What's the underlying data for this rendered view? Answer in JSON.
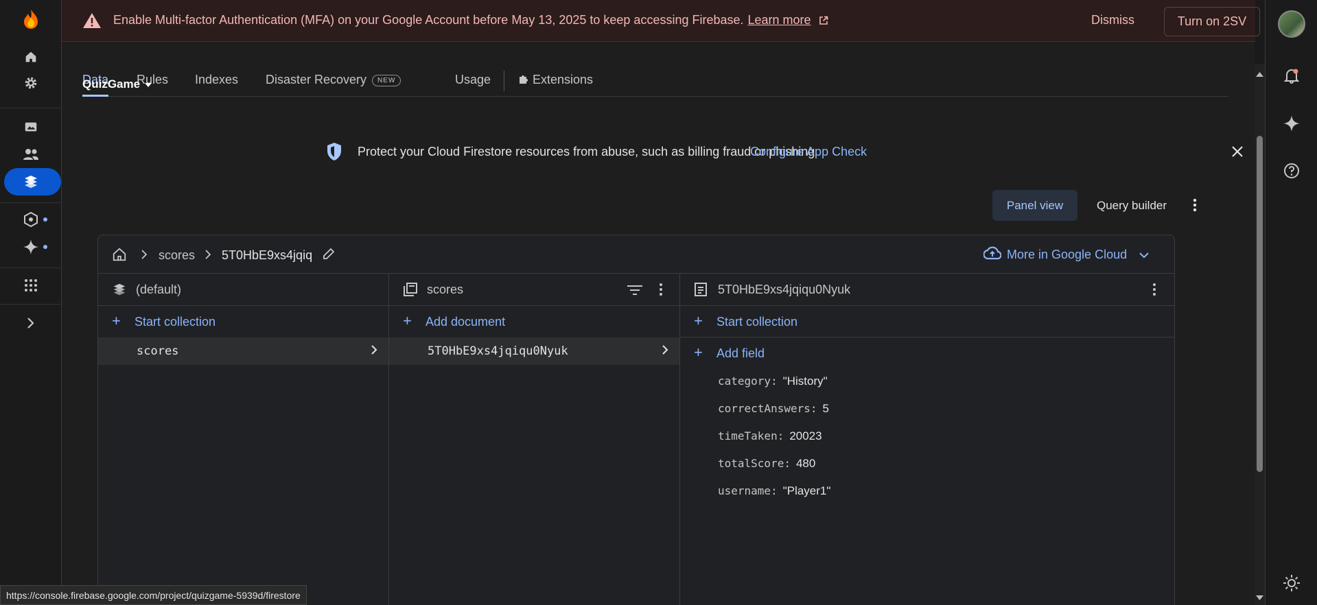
{
  "banner": {
    "message": "Enable Multi-factor Authentication (MFA) on your Google Account before May 13, 2025 to keep accessing Firebase.",
    "learn_more": "Learn more",
    "dismiss": "Dismiss",
    "turn_on": "Turn on 2SV"
  },
  "project": {
    "name": "QuizGame"
  },
  "tabs": [
    {
      "label": "Data"
    },
    {
      "label": "Rules"
    },
    {
      "label": "Indexes"
    },
    {
      "label": "Disaster Recovery",
      "badge": "NEW"
    },
    {
      "label": "Usage"
    },
    {
      "label": "Extensions"
    }
  ],
  "appcheck": {
    "text": "Protect your Cloud Firestore resources from abuse, such as billing fraud or phishing",
    "link": "Configure App Check"
  },
  "view": {
    "panel_view": "Panel view",
    "query_builder": "Query builder"
  },
  "breadcrumb": {
    "collection": "scores",
    "document": "5T0HbE9xs4jqiq"
  },
  "more_cloud": "More in Google Cloud",
  "columns": {
    "database": {
      "title": "(default)",
      "add_label": "Start collection",
      "items": [
        "scores"
      ]
    },
    "collection": {
      "title": "scores",
      "add_label": "Add document",
      "items": [
        "5T0HbE9xs4jqiqu0Nyuk"
      ]
    },
    "document": {
      "title": "5T0HbE9xs4jqiqu0Nyuk",
      "add_collection": "Start collection",
      "add_field": "Add field",
      "fields": [
        {
          "key": "category:",
          "value": "\"History\""
        },
        {
          "key": "correctAnswers:",
          "value": "5"
        },
        {
          "key": "timeTaken:",
          "value": "20023"
        },
        {
          "key": "totalScore:",
          "value": "480"
        },
        {
          "key": "username:",
          "value": "\"Player1\""
        }
      ]
    }
  },
  "status_url": "https://console.firebase.google.com/project/quizgame-5939d/firestore",
  "colors": {
    "accent": "#8ab4f8",
    "banner_text": "#f2b8b5",
    "active_rail": "#0b57d0"
  }
}
